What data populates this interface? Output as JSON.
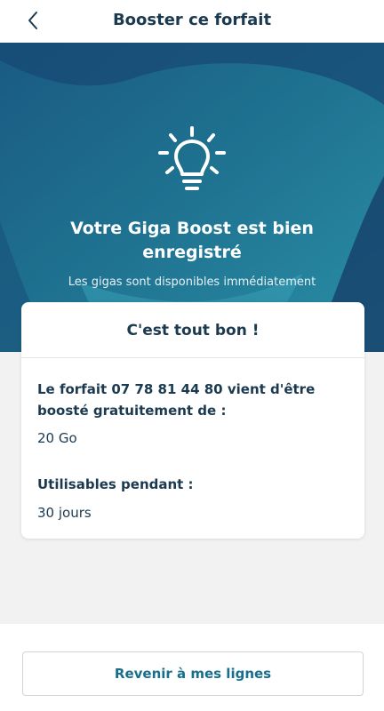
{
  "header": {
    "title": "Booster ce forfait",
    "back_icon": "chevron-left-icon"
  },
  "hero": {
    "icon": "lightbulb-icon",
    "title": "Votre Giga Boost est bien enregistré",
    "subtitle": "Les gigas sont disponibles immédiatement",
    "colors": {
      "background": "#1f6d8b",
      "dark": "#16406a",
      "light": "#3aa2b8"
    }
  },
  "card": {
    "title": "C'est tout bon !",
    "line_label": "Le forfait 07 78 81 44 80 vient d'être boosté gratuitement de :",
    "line_value": "20 Go",
    "duration_label": "Utilisables pendant :",
    "duration_value": "30 jours"
  },
  "footer": {
    "button_label": "Revenir à mes lignes",
    "accent": "#176f8c"
  }
}
